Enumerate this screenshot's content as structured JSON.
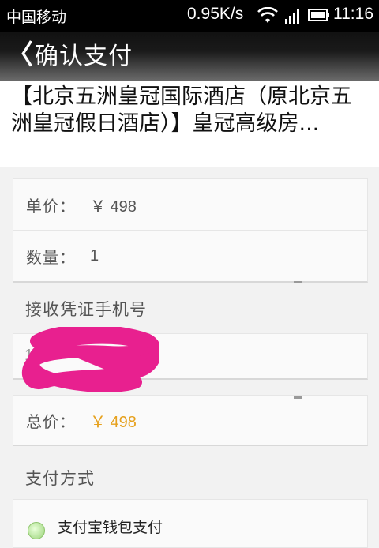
{
  "status_bar": {
    "carrier": "中国移动",
    "speed": "0.95K/s",
    "time": "11:16",
    "icons": [
      "wifi-icon",
      "signal-icon",
      "battery-icon"
    ]
  },
  "header": {
    "back_icon": "《",
    "title": "确认支付"
  },
  "hotel": {
    "title": "【北京五洲皇冠国际酒店（原北京五洲皇冠假日酒店）】皇冠高级房..."
  },
  "order": {
    "unit_price_label": "单价：",
    "unit_price_value": "￥ 498",
    "quantity_label": "数量：",
    "quantity_value": "1"
  },
  "phone": {
    "section_label": "接收凭证手机号",
    "value_visible": "1"
  },
  "total": {
    "label": "总价：",
    "value": "￥ 498"
  },
  "payment": {
    "section_label": "支付方式",
    "option_label": "支付宝钱包支付"
  },
  "colors": {
    "price_accent": "#e6a11e",
    "redaction": "#e8208f",
    "radio_green": "#9bd37a"
  }
}
